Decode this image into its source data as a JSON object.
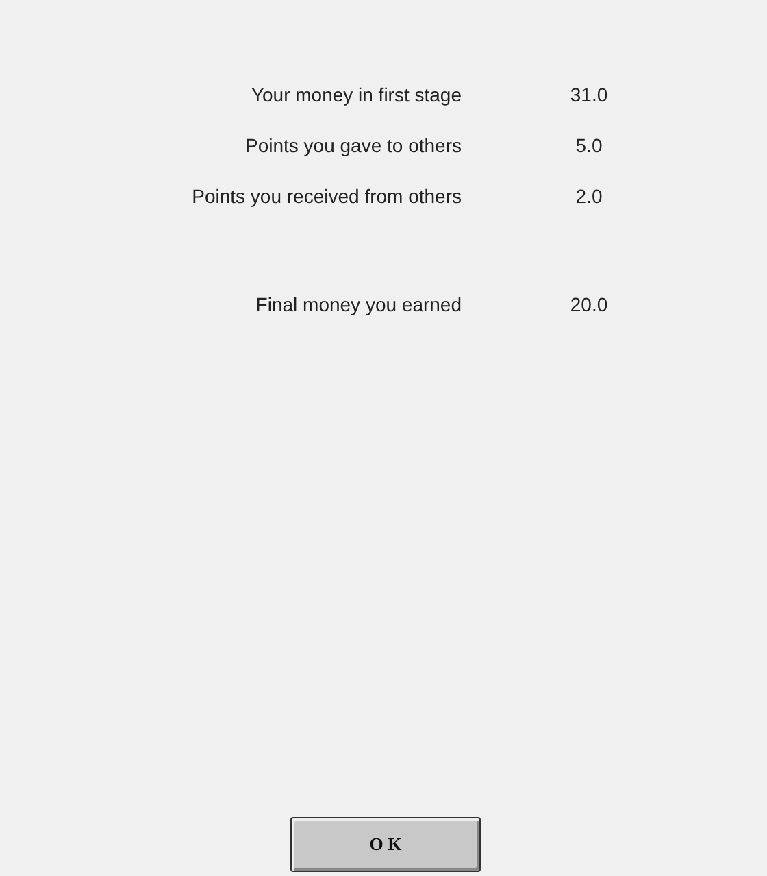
{
  "rows": [
    {
      "label": "Your money in first stage",
      "value": "31.0"
    },
    {
      "label": "Points you gave to others",
      "value": "5.0"
    },
    {
      "label": "Points you received from others",
      "value": "2.0"
    }
  ],
  "total": {
    "label": "Final money you earned",
    "value": "20.0"
  },
  "button": "O K"
}
